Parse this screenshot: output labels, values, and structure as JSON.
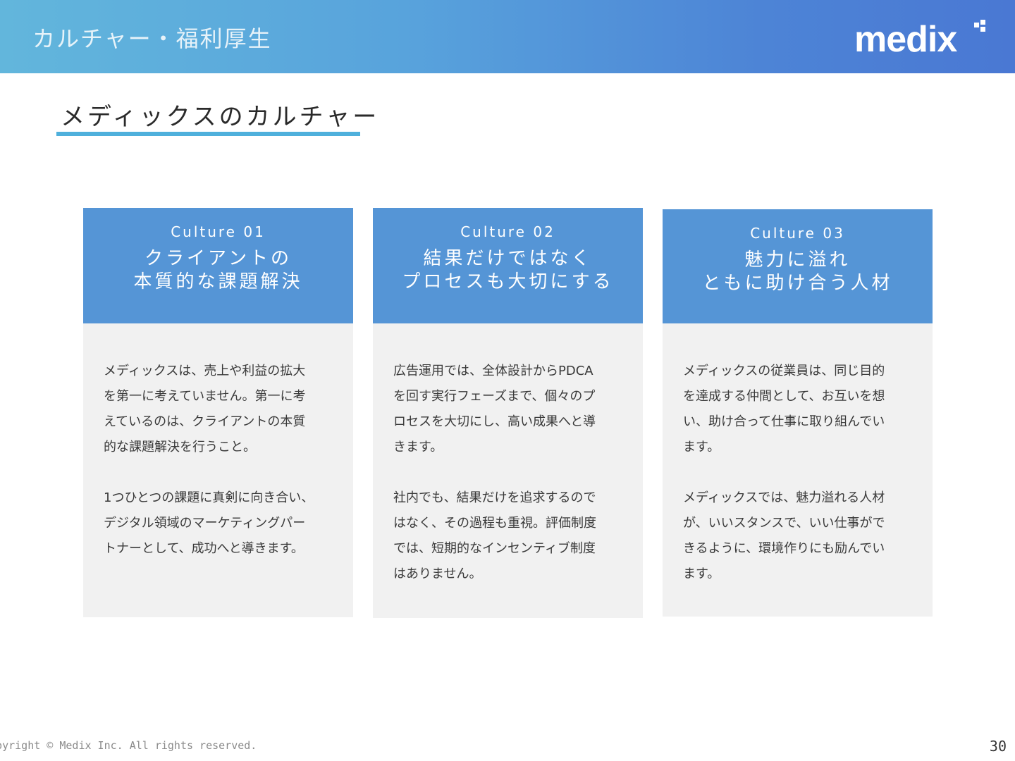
{
  "header": {
    "title": "カルチャー・福利厚生",
    "logo_text": "medix"
  },
  "section": {
    "title": "メディックスのカルチャー"
  },
  "cards": [
    {
      "label": "Culture 01",
      "heading_line1": "クライアントの",
      "heading_line2": "本質的な課題解決",
      "paragraph1": "メディックスは、売上や利益の拡大\nを第一に考えていません。第一に考\nえているのは、クライアントの本質\n的な課題解決を行うこと。",
      "paragraph2": "1つひとつの課題に真剣に向き合い、\nデジタル領域のマーケティングパー\nトナーとして、成功へと導きます。"
    },
    {
      "label": "Culture 02",
      "heading_line1": "結果だけではなく",
      "heading_line2": "プロセスも大切にする",
      "paragraph1": "広告運用では、全体設計からPDCA\nを回す実行フェーズまで、個々のプ\nロセスを大切にし、高い成果へと導\nきます。",
      "paragraph2": "社内でも、結果だけを追求するので\nはなく、その過程も重視。評価制度\nでは、短期的なインセンティブ制度\nはありません。"
    },
    {
      "label": "Culture 03",
      "heading_line1": "魅力に溢れ",
      "heading_line2": "ともに助け合う人材",
      "paragraph1": "メディックスの従業員は、同じ目的\nを達成する仲間として、お互いを想\nい、助け合って仕事に取り組んでい\nます。",
      "paragraph2": "メディックスでは、魅力溢れる人材\nが、いいスタンスで、いい仕事がで\nきるように、環境作りにも励んでい\nます。"
    }
  ],
  "footer": {
    "copyright": "Copyright © Medix Inc. All rights reserved.",
    "page_number": "30"
  },
  "colors": {
    "header_gradient_start": "#62b6dc",
    "header_gradient_end": "#4a78d3",
    "card_header": "#5595d6",
    "card_body": "#f1f1f1",
    "underline": "#4fb0dc"
  }
}
